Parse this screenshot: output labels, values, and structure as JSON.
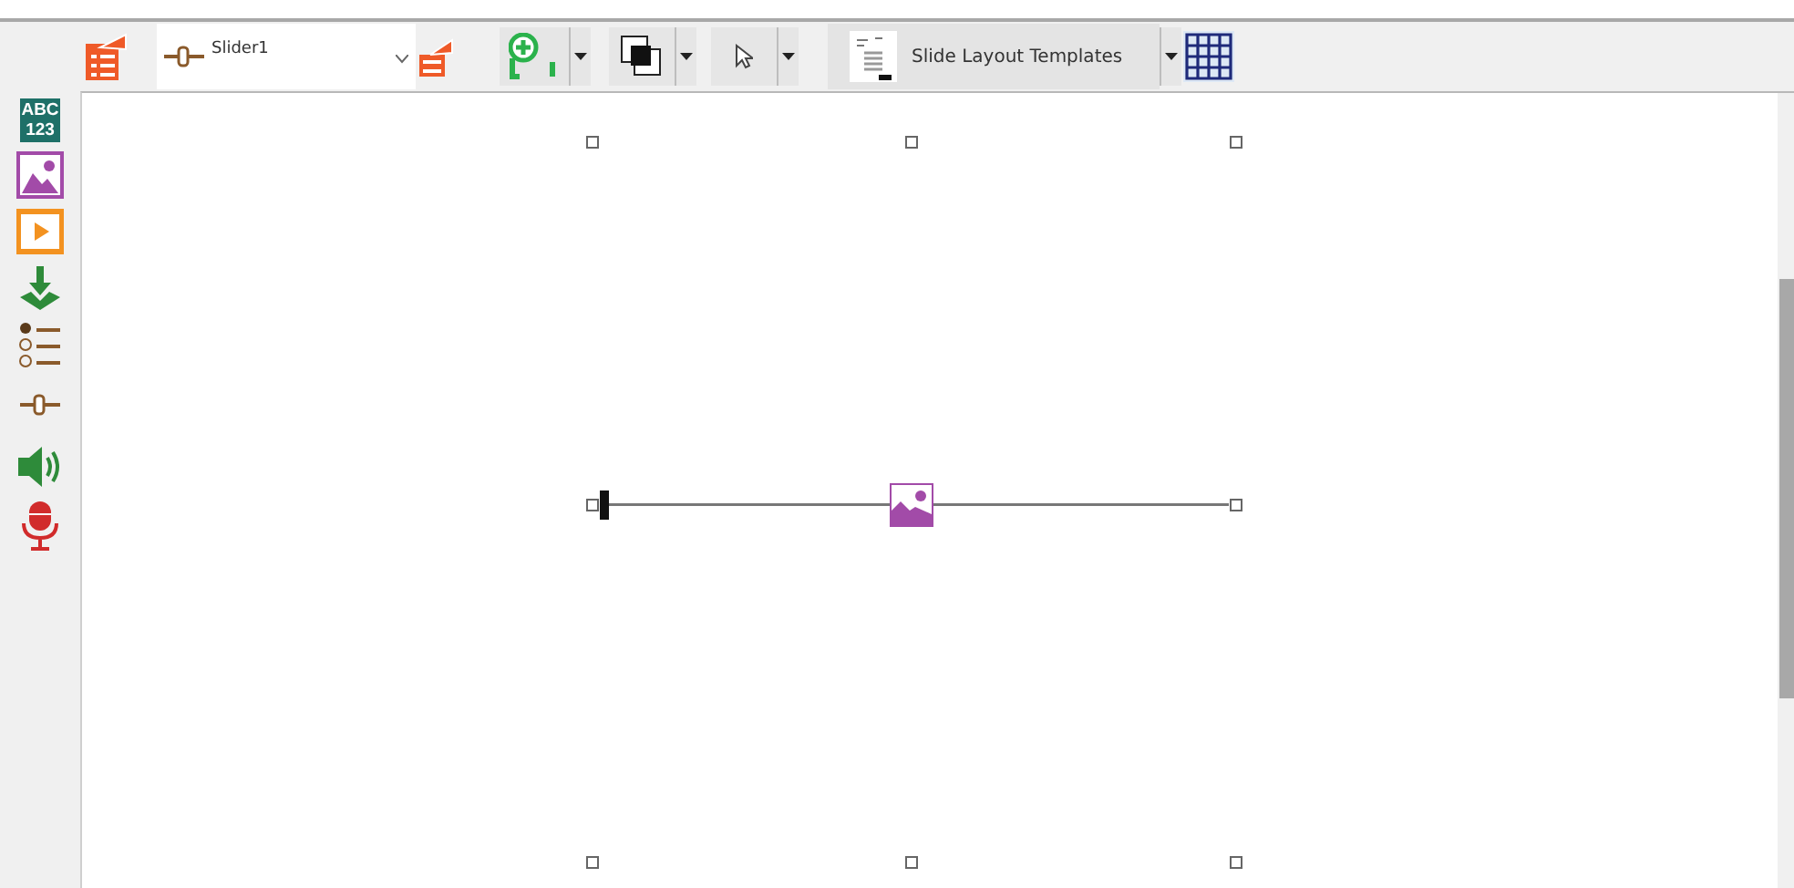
{
  "toolbar": {
    "control_selector": {
      "value": "Slider1"
    },
    "layout_templates_button": {
      "label": "Slide Layout Templates"
    }
  },
  "sidebar": {
    "text_tool": {
      "line_1": "ABC",
      "line_2": "123"
    }
  },
  "canvas": {
    "slider": {
      "level": 0
    }
  }
}
